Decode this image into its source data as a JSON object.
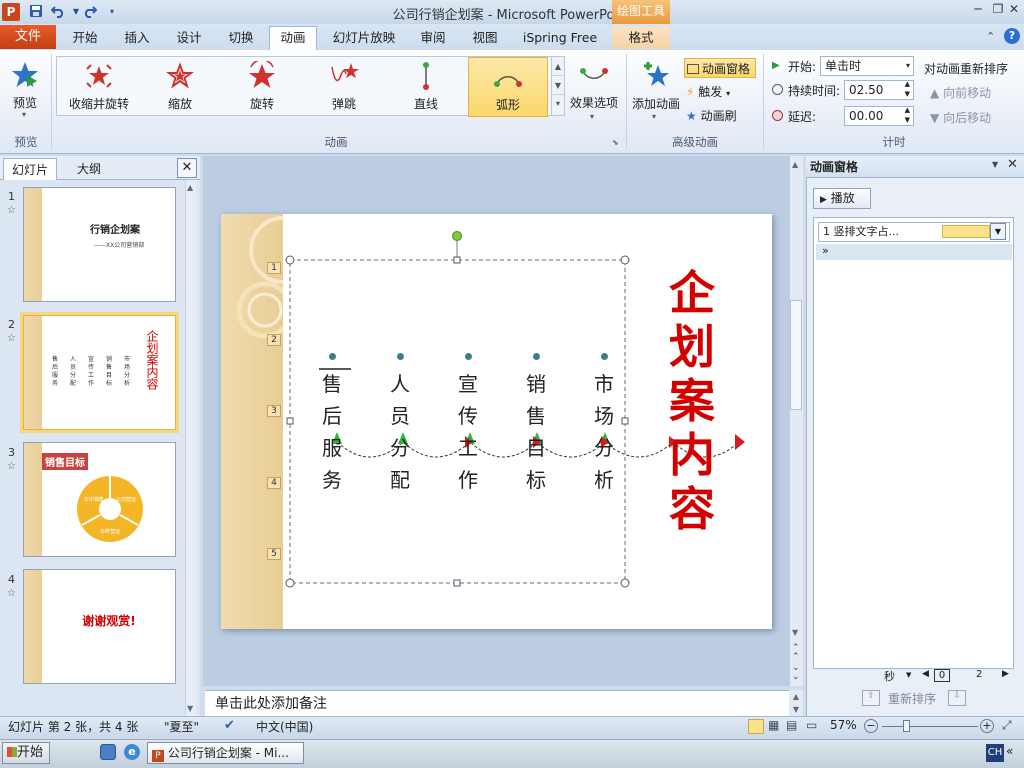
{
  "window": {
    "title": "公司行销企划案 - Microsoft PowerPoint",
    "context_group": "绘图工具"
  },
  "tabs": [
    "文件",
    "开始",
    "插入",
    "设计",
    "切换",
    "动画",
    "幻灯片放映",
    "审阅",
    "视图",
    "iSpring Free",
    "格式"
  ],
  "ribbon": {
    "preview": {
      "label": "预览",
      "group": "预览"
    },
    "animations": [
      {
        "label": "收缩并旋转",
        "icon": "shrink-turn-icon"
      },
      {
        "label": "缩放",
        "icon": "zoom-star-icon"
      },
      {
        "label": "旋转",
        "icon": "swivel-star-icon"
      },
      {
        "label": "弹跳",
        "icon": "bounce-star-icon"
      },
      {
        "label": "直线",
        "icon": "line-path-icon"
      },
      {
        "label": "弧形",
        "icon": "arc-path-icon"
      }
    ],
    "effect_options": "效果选项",
    "animation_group": "动画",
    "add_animation": "添加动画",
    "anim_pane_btn": "动画窗格",
    "trigger": "触发",
    "anim_painter": "动画刷",
    "advanced_group": "高级动画",
    "start_label": "开始:",
    "start_value": "单击时",
    "duration_label": "持续时间:",
    "duration_value": "02.50",
    "delay_label": "延迟:",
    "delay_value": "00.00",
    "reorder_title": "对动画重新排序",
    "move_earlier": "向前移动",
    "move_later": "向后移动",
    "timing_group": "计时"
  },
  "left_panel": {
    "tab_slides": "幻灯片",
    "tab_outline": "大纲",
    "close": "✕",
    "thumbs": [
      {
        "num": "1",
        "title": "行销企划案",
        "subtitle": "——XX公司营销部"
      },
      {
        "num": "2",
        "title": "企划案内容",
        "cols": [
          "售后服务",
          "人员分配",
          "宣传工作",
          "销售目标",
          "市场分析"
        ]
      },
      {
        "num": "3",
        "title": "销售目标",
        "ring": [
          "年中销售",
          "公司营运",
          "年终营运"
        ]
      },
      {
        "num": "4",
        "title": "谢谢观赏!"
      }
    ]
  },
  "slide": {
    "title": "企划案内容",
    "columns": [
      {
        "chars": [
          "售",
          "后",
          "服",
          "务"
        ],
        "num": "1"
      },
      {
        "chars": [
          "人",
          "员",
          "分",
          "配"
        ],
        "num": "2"
      },
      {
        "chars": [
          "宣",
          "传",
          "工",
          "作"
        ],
        "num": "3"
      },
      {
        "chars": [
          "销",
          "售",
          "目",
          "标"
        ],
        "num": "4"
      },
      {
        "chars": [
          "市",
          "场",
          "分",
          "析"
        ],
        "num": "5"
      }
    ]
  },
  "notes_placeholder": "单击此处添加备注",
  "animation_pane": {
    "title": "动画窗格",
    "play": "播放",
    "item_label": "1 竖排文字占...",
    "seconds_label": "秒",
    "timeline_start": "0",
    "timeline_end": "2",
    "reorder": "重新排序"
  },
  "status": {
    "slide_info": "幻灯片 第 2 张，共 4 张",
    "theme": "\"夏至\"",
    "language": "中文(中国)",
    "zoom": "57%"
  },
  "taskbar": {
    "start": "开始",
    "item": "公司行销企划案 - Mi...",
    "ime": "CH"
  },
  "colors": {
    "accent": "#d40000",
    "file_tab": "#d44a1a",
    "selected_gallery": "#fbe28a"
  }
}
